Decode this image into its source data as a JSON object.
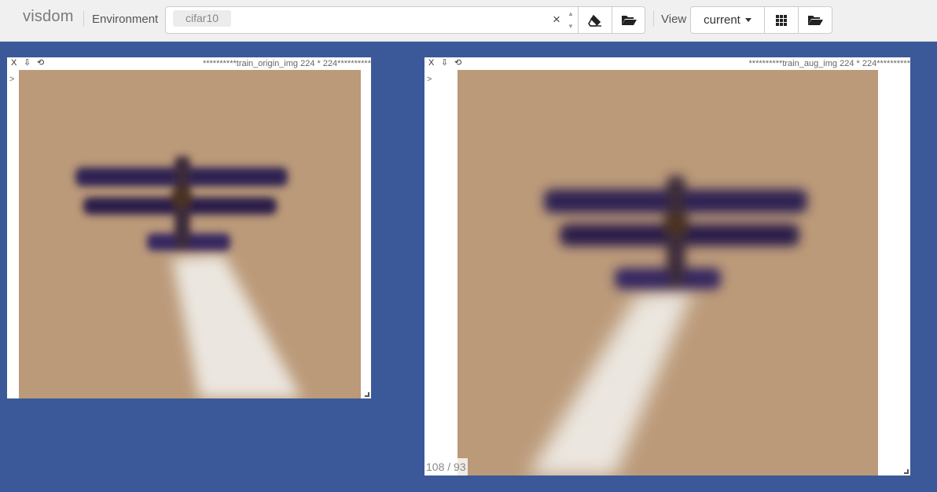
{
  "app": {
    "brand": "visdom"
  },
  "navbar": {
    "environment_label": "Environment",
    "environment_value": "cifar10",
    "clear_symbol": "×",
    "view_label": "View",
    "view_value": "current"
  },
  "panes": [
    {
      "title": "**********train_origin_img 224 * 224**********",
      "close": "X",
      "download": "⇩",
      "reset": "⟲",
      "prompt": ">"
    },
    {
      "title": "**********train_aug_img 224 * 224**********",
      "close": "X",
      "download": "⇩",
      "reset": "⟲",
      "prompt": ">",
      "counter": "108 / 93"
    }
  ],
  "colors": {
    "background": "#3b5998",
    "sky": "#bb9a79",
    "plane": "#2a1f4a",
    "smoke": "#e8e2da"
  }
}
